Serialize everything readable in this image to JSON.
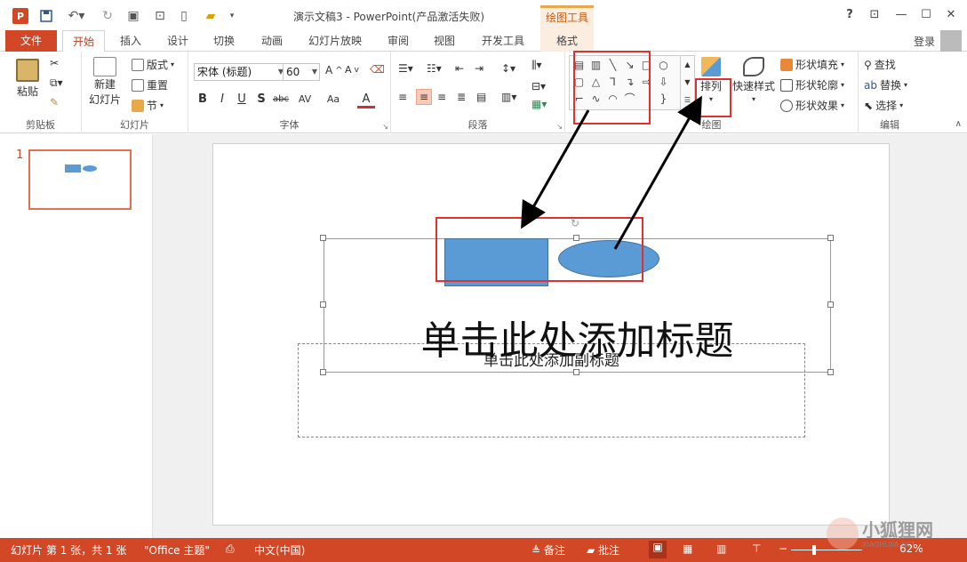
{
  "titlebar": {
    "app_icon": "P",
    "title": "演示文稿3 - PowerPoint(产品激活失败)",
    "context_tab": "绘图工具",
    "help": "?"
  },
  "tabs": {
    "file": "文件",
    "items": [
      "开始",
      "插入",
      "设计",
      "切换",
      "动画",
      "幻灯片放映",
      "审阅",
      "视图",
      "开发工具",
      "格式"
    ],
    "login": "登录"
  },
  "ribbon": {
    "clipboard": {
      "paste": "粘贴",
      "label": "剪贴板"
    },
    "slides": {
      "new_slide_1": "新建",
      "new_slide_2": "幻灯片",
      "layout": "版式",
      "reset": "重置",
      "section": "节",
      "label": "幻灯片"
    },
    "font": {
      "font_name": "宋体 (标题)",
      "font_size": "60",
      "label": "字体",
      "bold": "B",
      "italic": "I",
      "underline": "U",
      "shadow": "S",
      "strike": "abc",
      "spacing": "AV",
      "case": "Aa",
      "color": "A"
    },
    "paragraph": {
      "label": "段落"
    },
    "drawing": {
      "arrange": "排列",
      "quick_styles": "快速样式",
      "shape_fill": "形状填充",
      "shape_outline": "形状轮廓",
      "shape_effects": "形状效果",
      "label": "绘图"
    },
    "editing": {
      "find": "查找",
      "replace": "替换",
      "select": "选择",
      "label": "编辑"
    }
  },
  "thumbs": {
    "number": "1"
  },
  "slide": {
    "title_placeholder": "单击此处添加标题",
    "subtitle_placeholder": "单击此处添加副标题"
  },
  "statusbar": {
    "slide_info": "幻灯片 第 1 张，共 1 张",
    "theme": "\"Office 主题\"",
    "language": "中文(中国)",
    "notes": "备注",
    "comments": "批注",
    "zoom": "62%"
  },
  "watermark": {
    "text": "小狐狸网",
    "domain": "XIAOHUJIA.NET"
  },
  "colors": {
    "accent": "#d24726",
    "shape_fill": "#5b9bd5",
    "annotation": "#e03030"
  }
}
